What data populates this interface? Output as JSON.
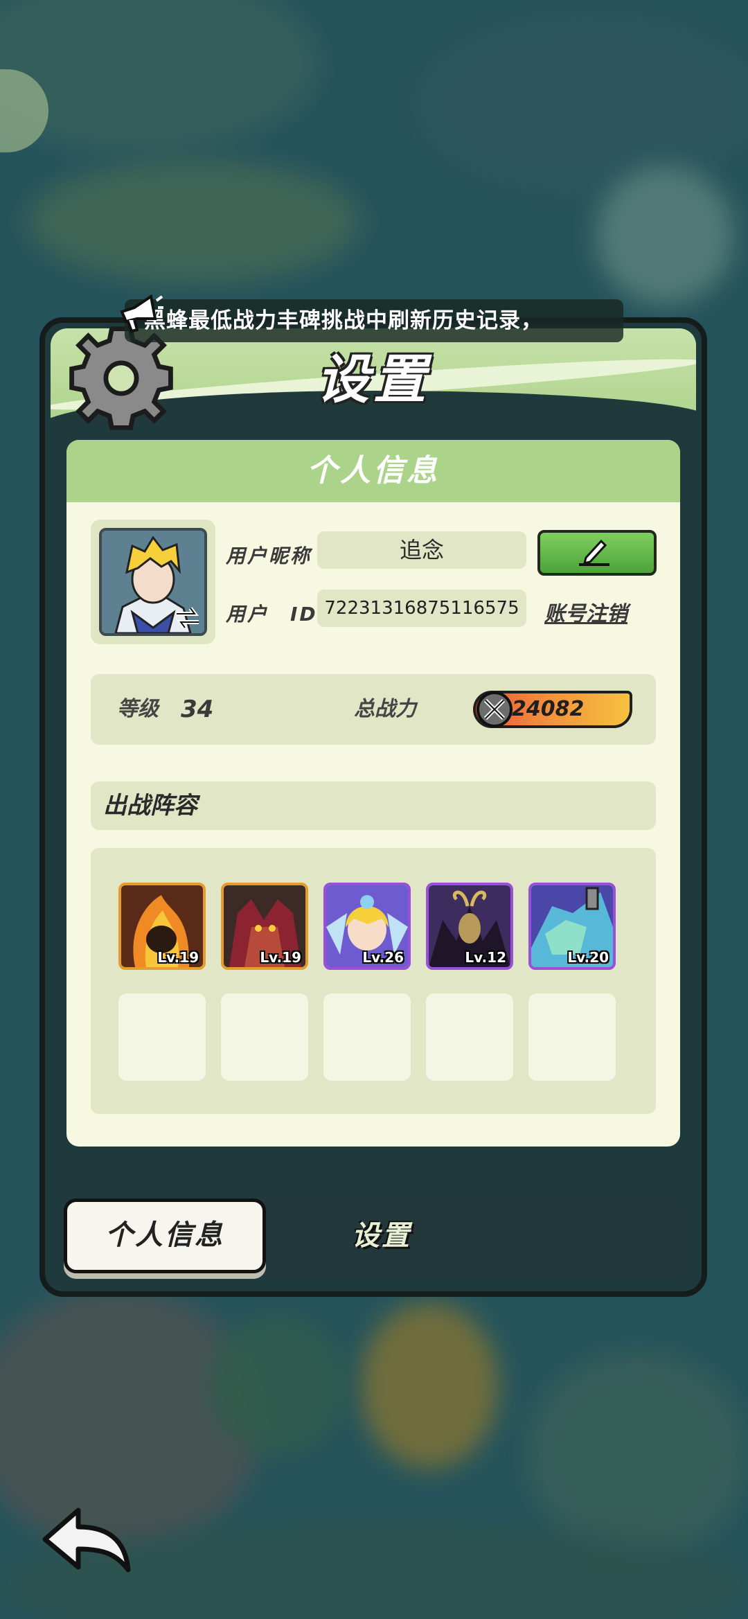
{
  "announcement": {
    "text": "黑蜂最低战力丰碑挑战中刷新历史记录，"
  },
  "dialog": {
    "title": "设置"
  },
  "profile": {
    "section_title": "个人信息",
    "nickname_label": "用户昵称",
    "nickname": "追念",
    "id_label": "用户　ID",
    "user_id": "72231316875116575",
    "logout_link": "账号注销",
    "edit_icon": "pencil-icon"
  },
  "stats": {
    "level_label": "等级",
    "level": "34",
    "power_label": "总战力",
    "power": "24082"
  },
  "team": {
    "title": "出战阵容",
    "heroes": [
      {
        "level": "Lv.19",
        "rarity_color": "#e59b2d",
        "bg": "#5a2b18"
      },
      {
        "level": "Lv.19",
        "rarity_color": "#e59b2d",
        "bg": "#3c2a26"
      },
      {
        "level": "Lv.26",
        "rarity_color": "#9a4fd8",
        "bg": "#6f5bd0"
      },
      {
        "level": "Lv.12",
        "rarity_color": "#9a4fd8",
        "bg": "#3d2d5e"
      },
      {
        "level": "Lv.20",
        "rarity_color": "#9a4fd8",
        "bg": "#4a47a8"
      }
    ],
    "empty_slots": 5
  },
  "tabs": [
    {
      "label": "个人信息",
      "active": true
    },
    {
      "label": "设置",
      "active": false
    }
  ],
  "colors": {
    "panel_header": "#acd38a",
    "panel_bg": "#f6f8e2",
    "edit_button": "#5fb845"
  }
}
